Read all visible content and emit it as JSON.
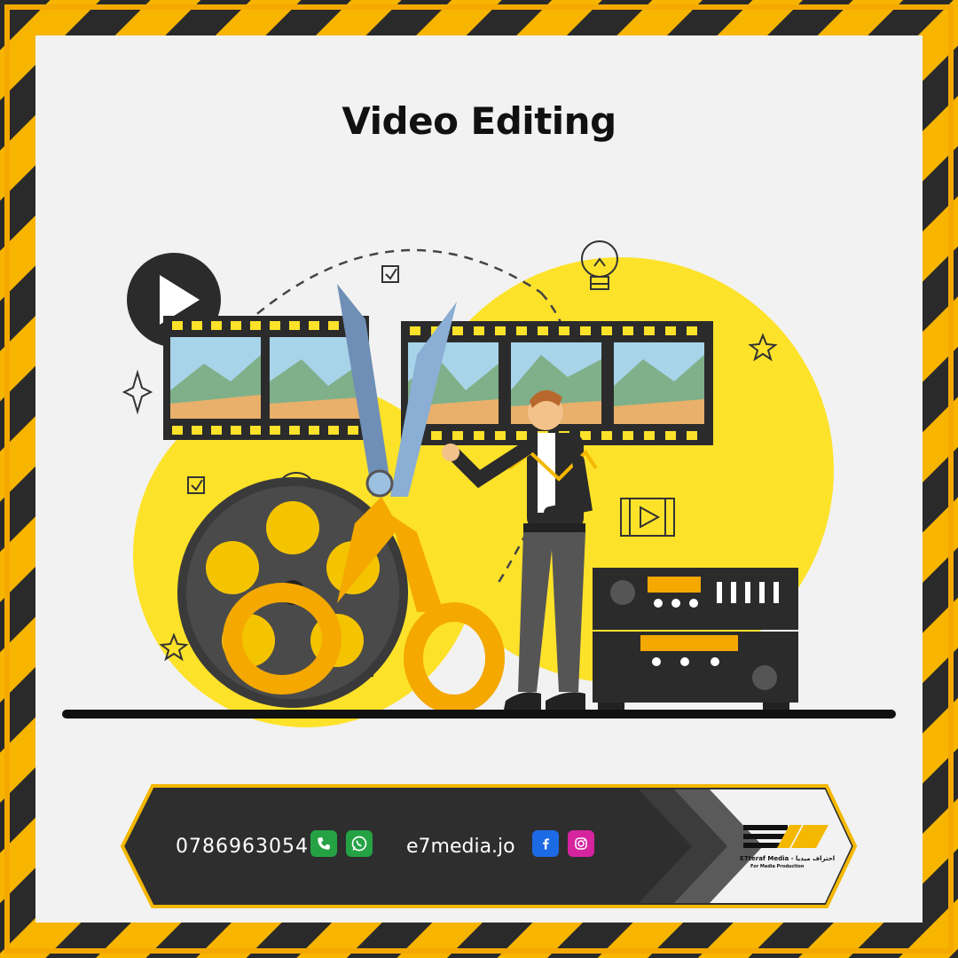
{
  "title": "Video Editing",
  "footer": {
    "phone": "0786963054",
    "website": "e7media.jo",
    "icons": [
      "phone-icon",
      "whatsapp-icon",
      "facebook-icon",
      "instagram-icon"
    ],
    "brand_name": "E7teraf Media - احتراف ميديا",
    "brand_tagline": "For Media Production"
  },
  "colors": {
    "accent_yellow": "#f5c400",
    "frame_orange": "#f4a800",
    "dark": "#2b2b2b",
    "panel": "#f2f2f2"
  }
}
